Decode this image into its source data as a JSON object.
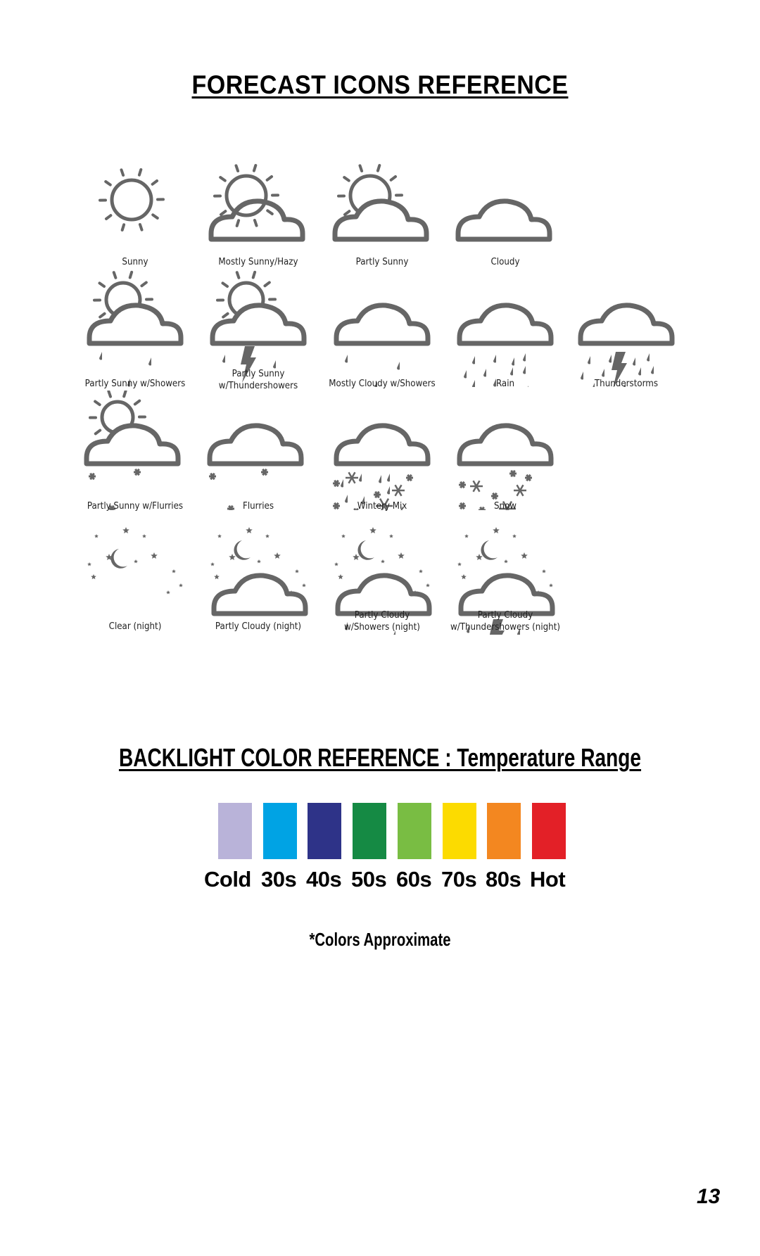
{
  "forecast_section": {
    "title": "FORECAST ICONS REFERENCE",
    "icons": [
      {
        "label": "Sunny",
        "icon": "sunny-icon"
      },
      {
        "label": "Mostly Sunny/Hazy",
        "icon": "mostly-sunny-hazy-icon"
      },
      {
        "label": "Partly Sunny",
        "icon": "partly-sunny-icon"
      },
      {
        "label": "Cloudy",
        "icon": "cloudy-icon"
      },
      {
        "label": "Partly Sunny w/Showers",
        "icon": "partly-sunny-showers-icon"
      },
      {
        "label": "Partly Sunny w/Thundershowers",
        "icon": "partly-sunny-thundershowers-icon"
      },
      {
        "label": "Mostly Cloudy w/Showers",
        "icon": "mostly-cloudy-showers-icon"
      },
      {
        "label": "Rain",
        "icon": "rain-icon"
      },
      {
        "label": "Thunderstorms",
        "icon": "thunderstorms-icon"
      },
      {
        "label": "Partly Sunny w/Flurries",
        "icon": "partly-sunny-flurries-icon"
      },
      {
        "label": "Flurries",
        "icon": "flurries-icon"
      },
      {
        "label": "Wintery Mix",
        "icon": "wintery-mix-icon"
      },
      {
        "label": "Snow",
        "icon": "snow-icon"
      },
      {
        "label": "Clear (night)",
        "icon": "clear-night-icon"
      },
      {
        "label": "Partly Cloudy (night)",
        "icon": "partly-cloudy-night-icon"
      },
      {
        "label": "Partly Cloudy w/Showers (night)",
        "icon": "partly-cloudy-showers-night-icon"
      },
      {
        "label": "Partly Cloudy w/Thundershowers (night)",
        "icon": "partly-cloudy-thundershowers-night-icon"
      }
    ]
  },
  "backlight_section": {
    "title": "BACKLIGHT COLOR REFERENCE : Temperature Range",
    "ranges": [
      {
        "label": "Cold",
        "color": "#b9b3d9"
      },
      {
        "label": "30s",
        "color": "#00a3e4"
      },
      {
        "label": "40s",
        "color": "#2e3388"
      },
      {
        "label": "50s",
        "color": "#158a44"
      },
      {
        "label": "60s",
        "color": "#79bd43"
      },
      {
        "label": "70s",
        "color": "#fcdb00"
      },
      {
        "label": "80s",
        "color": "#f38720"
      },
      {
        "label": "Hot",
        "color": "#e32027"
      }
    ],
    "note": "*Colors Approximate"
  },
  "page_number": "13"
}
